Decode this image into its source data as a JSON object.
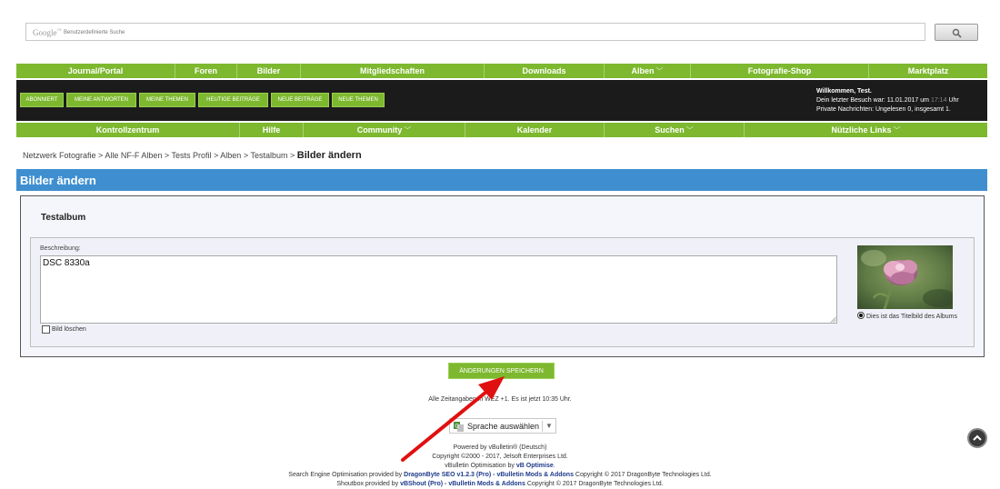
{
  "search": {
    "brand": "Google",
    "placeholder": "Benutzerdefinierte Suche",
    "button_icon": "search-icon"
  },
  "nav_top": [
    {
      "label": "Journal/Portal",
      "caret": false
    },
    {
      "label": "Foren",
      "caret": false
    },
    {
      "label": "Bilder",
      "caret": false
    },
    {
      "label": "Mitgliedschaften",
      "caret": false
    },
    {
      "label": "Downloads",
      "caret": false
    },
    {
      "label": "Alben",
      "caret": true
    },
    {
      "label": "Fotografie-Shop",
      "caret": false
    },
    {
      "label": "Marktplatz",
      "caret": false
    }
  ],
  "quick_links": [
    "ABONNIERT",
    "MEINE ANTWORTEN",
    "MEINE THEMEN",
    "HEUTIGE BEITRÄGE",
    "NEUE BEITRÄGE",
    "NEUE THEMEN"
  ],
  "welcome": {
    "greeting": "Willkommen, Test.",
    "last_visit_prefix": "Dein letzter Besuch war: 11.01.2017 um",
    "last_visit_time": "17:14",
    "last_visit_suffix": "Uhr",
    "pm": "Private Nachrichten: Ungelesen 0, insgesamt 1."
  },
  "nav_bottom": [
    {
      "label": "Kontrollzentrum",
      "caret": false
    },
    {
      "label": "Hilfe",
      "caret": false
    },
    {
      "label": "Community",
      "caret": true
    },
    {
      "label": "Kalender",
      "caret": false
    },
    {
      "label": "Suchen",
      "caret": true
    },
    {
      "label": "Nützliche Links",
      "caret": true
    }
  ],
  "breadcrumb": {
    "items": [
      "Netzwerk Fotografie",
      "Alle NF-F Alben",
      "Tests Profil",
      "Alben",
      "Testalbum"
    ],
    "separator": ">",
    "current": "Bilder ändern"
  },
  "page_header": "Bilder ändern",
  "album": {
    "title": "Testalbum",
    "description_label": "Beschreibung:",
    "description_value": "DSC 8330a",
    "delete_label": "Bild löschen",
    "delete_checked": false,
    "cover_label": "Dies ist das Titelbild des Albums",
    "cover_selected": true
  },
  "save_button": "ÄNDERUNGEN SPEICHERN",
  "footer": {
    "timezone": "Alle Zeitangaben in WEZ +1. Es ist jetzt 10:35 Uhr.",
    "language": "Sprache auswählen",
    "powered": "Powered by vBulletin® (Deutsch)",
    "copyright": "Copyright ©2000 - 2017, Jelsoft Enterprises Ltd.",
    "optimisation_prefix": "vBulletin Optimisation by",
    "optimisation_link": "vB Optimise",
    "seo_prefix": "Search Engine Optimisation provided by",
    "seo_link": "DragonByte SEO v1.2.3 (Pro) - vBulletin Mods & Addons",
    "seo_suffix": "Copyright © 2017 DragonByte Technologies Ltd.",
    "shout_prefix": "Shoutbox provided by",
    "shout_link": "vBShout (Pro) - vBulletin Mods & Addons",
    "shout_suffix": "Copyright © 2017 DragonByte Technologies Ltd."
  },
  "colors": {
    "green": "#7db82f",
    "blue_header": "#3f8fd0",
    "dark_bar": "#1b1b1b",
    "annotation_arrow": "#e01010"
  }
}
